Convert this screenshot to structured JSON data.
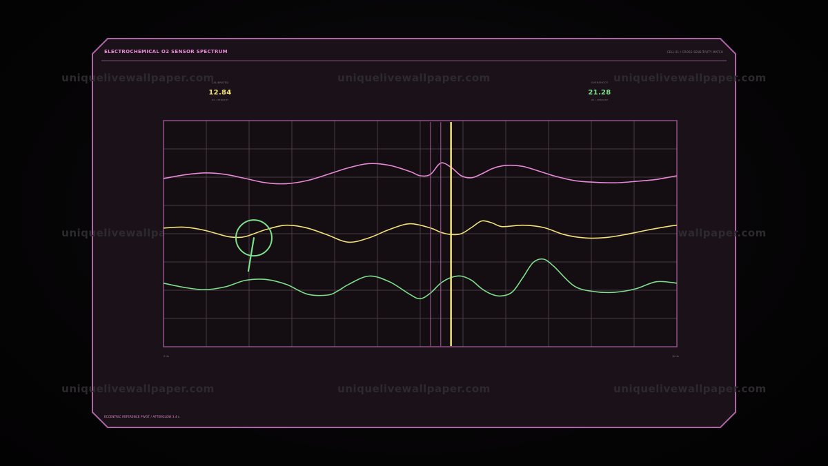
{
  "colors": {
    "frame": "#b064a8",
    "panel_fill": "#1a1218",
    "pink": "#e88ad8",
    "yellow": "#f4e27a",
    "green": "#7ee08c",
    "grid": "#4c3a47",
    "text_dim": "#8a7686",
    "watermark": "#2d2a2d"
  },
  "header": {
    "title": "ELECTROCHEMICAL O2 SENSOR SPECTRUM",
    "subtitle": "CELL 01 / CROSS-SENSITIVITY MATCH"
  },
  "readouts": [
    {
      "label": "CALIBRATED",
      "value": "12.84",
      "caption": "O2 / PERCENT",
      "color": "#f4e27a"
    },
    {
      "label": "OVERSHOOT",
      "value": "21.28",
      "caption": "O2 / PERCENT",
      "color": "#7ee08c"
    }
  ],
  "footer": {
    "text": "ECCENTRIC REFERENCE PIVOT / AFTERGLOW 3.4 ε"
  },
  "axis": {
    "left_label": "0 Hz",
    "right_label": "1k Hz"
  },
  "watermark": {
    "text": "uniquelivewallpaper.com"
  },
  "chart_data": {
    "type": "line",
    "xlim": [
      0,
      100
    ],
    "ylim": [
      0,
      8
    ],
    "grid": true,
    "grid_divisions": {
      "x": 12,
      "y": 8
    },
    "series": [
      {
        "color": "#e88ad8",
        "x": [
          0,
          4,
          8,
          12,
          16,
          20,
          24,
          28,
          32,
          36,
          40,
          44,
          48,
          50,
          52,
          54,
          56,
          58,
          60,
          62,
          64,
          66,
          68,
          70,
          72,
          76,
          80,
          84,
          88,
          92,
          96,
          100
        ],
        "y": [
          5.95,
          6.08,
          6.15,
          6.1,
          5.95,
          5.8,
          5.77,
          5.88,
          6.1,
          6.33,
          6.48,
          6.42,
          6.2,
          6.05,
          6.1,
          6.5,
          6.35,
          6.05,
          5.98,
          6.12,
          6.3,
          6.4,
          6.42,
          6.38,
          6.28,
          6.05,
          5.88,
          5.82,
          5.8,
          5.85,
          5.92,
          6.05
        ]
      },
      {
        "color": "#f4e27a",
        "x": [
          0,
          4,
          8,
          12,
          14,
          16,
          20,
          24,
          28,
          32,
          36,
          40,
          44,
          48,
          52,
          54,
          56,
          58,
          60,
          62,
          64,
          66,
          70,
          74,
          78,
          82,
          86,
          90,
          94,
          98,
          100
        ],
        "y": [
          4.2,
          4.23,
          4.12,
          3.92,
          3.87,
          3.9,
          4.15,
          4.3,
          4.2,
          3.95,
          3.7,
          3.85,
          4.15,
          4.35,
          4.2,
          4.05,
          3.97,
          4.0,
          4.22,
          4.45,
          4.38,
          4.25,
          4.3,
          4.22,
          3.97,
          3.85,
          3.86,
          3.97,
          4.12,
          4.25,
          4.3
        ]
      },
      {
        "color": "#7ee08c",
        "x": [
          0,
          4,
          8,
          12,
          16,
          20,
          24,
          28,
          32,
          34,
          36,
          40,
          44,
          48,
          50,
          52,
          54,
          56,
          58,
          60,
          62,
          64,
          66,
          68,
          70,
          72,
          74,
          76,
          80,
          84,
          88,
          92,
          96,
          100
        ],
        "y": [
          2.25,
          2.1,
          2.02,
          2.12,
          2.35,
          2.38,
          2.2,
          1.86,
          1.83,
          1.98,
          2.2,
          2.5,
          2.3,
          1.85,
          1.7,
          1.9,
          2.25,
          2.45,
          2.5,
          2.35,
          2.05,
          1.85,
          1.8,
          1.95,
          2.45,
          2.98,
          3.1,
          2.85,
          2.15,
          1.95,
          1.93,
          2.05,
          2.3,
          2.25
        ]
      }
    ],
    "vlines": [
      {
        "x": 52.0,
        "color": "#b064a8"
      },
      {
        "x": 54.0,
        "color": "#b064a8"
      },
      {
        "x": 56.0,
        "color": "#f4e27a"
      }
    ],
    "marker": {
      "x": 17.6,
      "y": 3.85,
      "color": "#7ee08c"
    }
  }
}
